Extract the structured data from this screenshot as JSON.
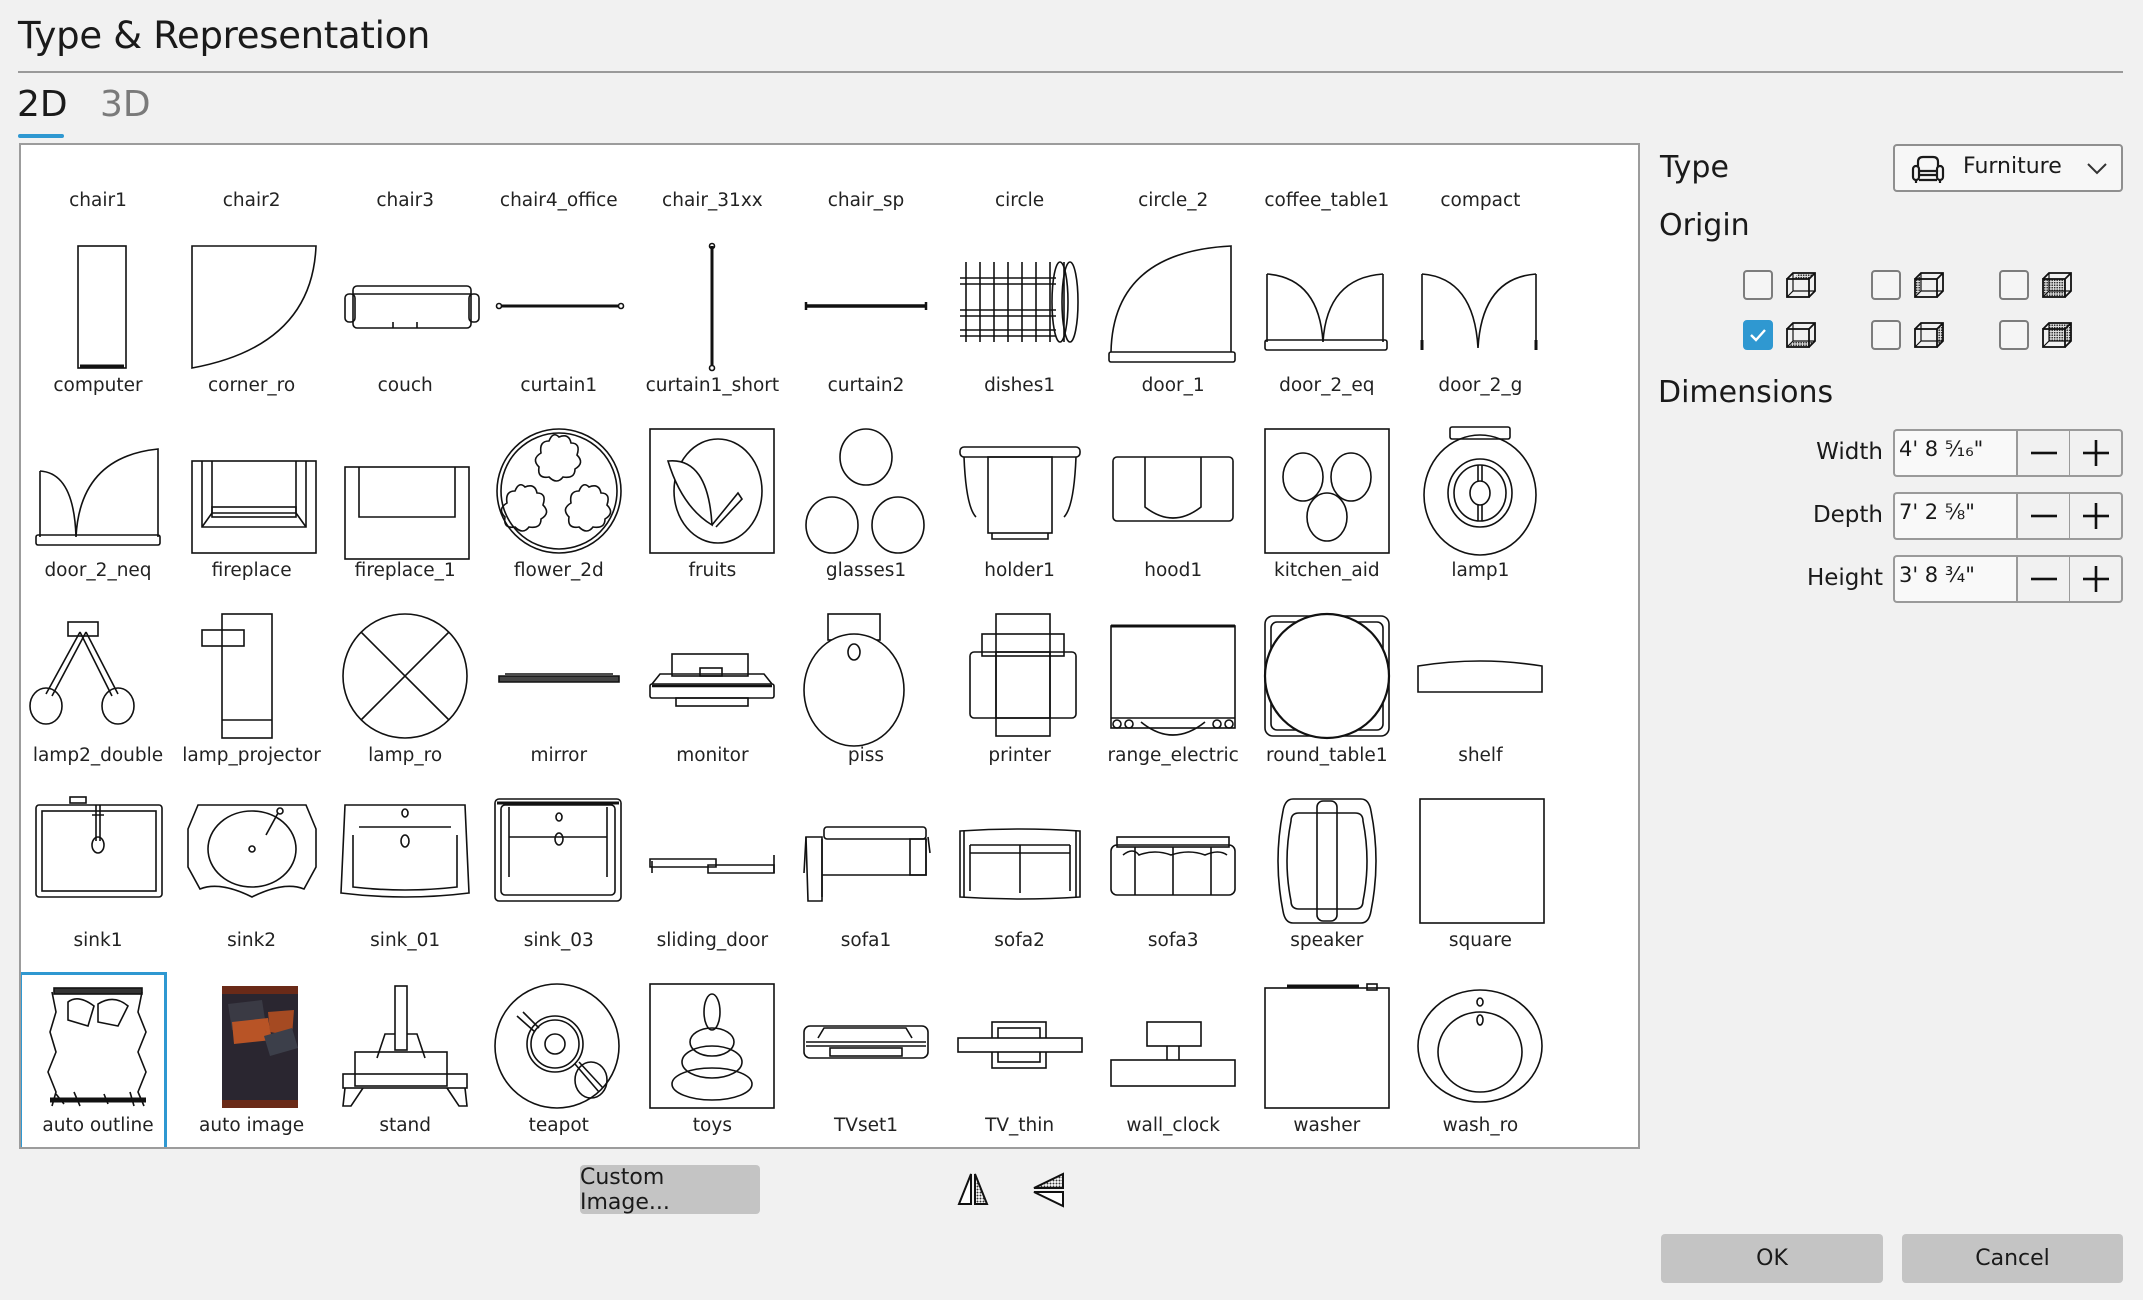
{
  "dialog": {
    "title": "Type & Representation"
  },
  "tabs": [
    {
      "label": "2D",
      "active": true
    },
    {
      "label": "3D",
      "active": false
    }
  ],
  "grid": {
    "selected": "auto outline",
    "items": [
      {
        "label": "chair1",
        "icon": "chair1"
      },
      {
        "label": "chair2",
        "icon": "chair2"
      },
      {
        "label": "chair3",
        "icon": "chair3"
      },
      {
        "label": "chair4_office",
        "icon": "chair4_office"
      },
      {
        "label": "chair_31xx",
        "icon": "chair_31xx"
      },
      {
        "label": "chair_sp",
        "icon": "chair_sp"
      },
      {
        "label": "circle",
        "icon": "circle"
      },
      {
        "label": "circle_2",
        "icon": "circle_2"
      },
      {
        "label": "coffee_table1",
        "icon": "coffee_table1"
      },
      {
        "label": "compact",
        "icon": "compact"
      },
      {
        "label": "computer",
        "icon": "computer"
      },
      {
        "label": "corner_ro",
        "icon": "corner_ro"
      },
      {
        "label": "couch",
        "icon": "couch"
      },
      {
        "label": "curtain1",
        "icon": "curtain1"
      },
      {
        "label": "curtain1_short",
        "icon": "curtain1_short"
      },
      {
        "label": "curtain2",
        "icon": "curtain2"
      },
      {
        "label": "dishes1",
        "icon": "dishes1"
      },
      {
        "label": "door_1",
        "icon": "door_1"
      },
      {
        "label": "door_2_eq",
        "icon": "door_2_eq"
      },
      {
        "label": "door_2_g",
        "icon": "door_2_g"
      },
      {
        "label": "door_2_neq",
        "icon": "door_2_neq"
      },
      {
        "label": "fireplace",
        "icon": "fireplace"
      },
      {
        "label": "fireplace_1",
        "icon": "fireplace_1"
      },
      {
        "label": "flower_2d",
        "icon": "flower_2d"
      },
      {
        "label": "fruits",
        "icon": "fruits"
      },
      {
        "label": "glasses1",
        "icon": "glasses1"
      },
      {
        "label": "holder1",
        "icon": "holder1"
      },
      {
        "label": "hood1",
        "icon": "hood1"
      },
      {
        "label": "kitchen_aid",
        "icon": "kitchen_aid"
      },
      {
        "label": "lamp1",
        "icon": "lamp1"
      },
      {
        "label": "lamp2_double",
        "icon": "lamp2_double"
      },
      {
        "label": "lamp_projector",
        "icon": "lamp_projector"
      },
      {
        "label": "lamp_ro",
        "icon": "lamp_ro"
      },
      {
        "label": "mirror",
        "icon": "mirror"
      },
      {
        "label": "monitor",
        "icon": "monitor"
      },
      {
        "label": "piss",
        "icon": "piss"
      },
      {
        "label": "printer",
        "icon": "printer"
      },
      {
        "label": "range_electric",
        "icon": "range_electric"
      },
      {
        "label": "round_table1",
        "icon": "round_table1"
      },
      {
        "label": "shelf",
        "icon": "shelf"
      },
      {
        "label": "sink1",
        "icon": "sink1"
      },
      {
        "label": "sink2",
        "icon": "sink2"
      },
      {
        "label": "sink_01",
        "icon": "sink_01"
      },
      {
        "label": "sink_03",
        "icon": "sink_03"
      },
      {
        "label": "sliding_door",
        "icon": "sliding_door"
      },
      {
        "label": "sofa1",
        "icon": "sofa1"
      },
      {
        "label": "sofa2",
        "icon": "sofa2"
      },
      {
        "label": "sofa3",
        "icon": "sofa3"
      },
      {
        "label": "speaker",
        "icon": "speaker"
      },
      {
        "label": "square",
        "icon": "square"
      },
      {
        "label": "auto outline",
        "icon": "auto_outline"
      },
      {
        "label": "auto image",
        "icon": "auto_image"
      },
      {
        "label": "stand",
        "icon": "stand"
      },
      {
        "label": "teapot",
        "icon": "teapot"
      },
      {
        "label": "toys",
        "icon": "toys"
      },
      {
        "label": "TVset1",
        "icon": "tvset1"
      },
      {
        "label": "TV_thin",
        "icon": "tv_thin"
      },
      {
        "label": "wall_clock",
        "icon": "wall_clock"
      },
      {
        "label": "washer",
        "icon": "washer"
      },
      {
        "label": "wash_ro",
        "icon": "wash_ro"
      }
    ]
  },
  "type_section": {
    "label": "Type",
    "dropdown": {
      "value": "Furniture",
      "icon": "armchair-icon"
    }
  },
  "origin_section": {
    "label": "Origin",
    "options": [
      {
        "face": "top",
        "checked": false
      },
      {
        "face": "left",
        "checked": false
      },
      {
        "face": "front",
        "checked": false
      },
      {
        "face": "bottom",
        "checked": true
      },
      {
        "face": "right",
        "checked": false
      },
      {
        "face": "back",
        "checked": false
      }
    ]
  },
  "dimensions_section": {
    "label": "Dimensions",
    "fields": [
      {
        "label": "Width",
        "value": "4' 8 ⁵⁄₁₆\""
      },
      {
        "label": "Depth",
        "value": "7' 2 ⅝\""
      },
      {
        "label": "Height",
        "value": "3' 8 ¾\""
      }
    ]
  },
  "bottom": {
    "custom_image_label": "Custom Image...",
    "flip_horizontal_icon": "flip-horizontal-icon",
    "flip_vertical_icon": "flip-vertical-icon",
    "ok_label": "OK",
    "cancel_label": "Cancel"
  },
  "colors": {
    "accent": "#2f98d1",
    "button_bg": "#c4c4c4",
    "dialog_bg": "#f1f1f1"
  }
}
